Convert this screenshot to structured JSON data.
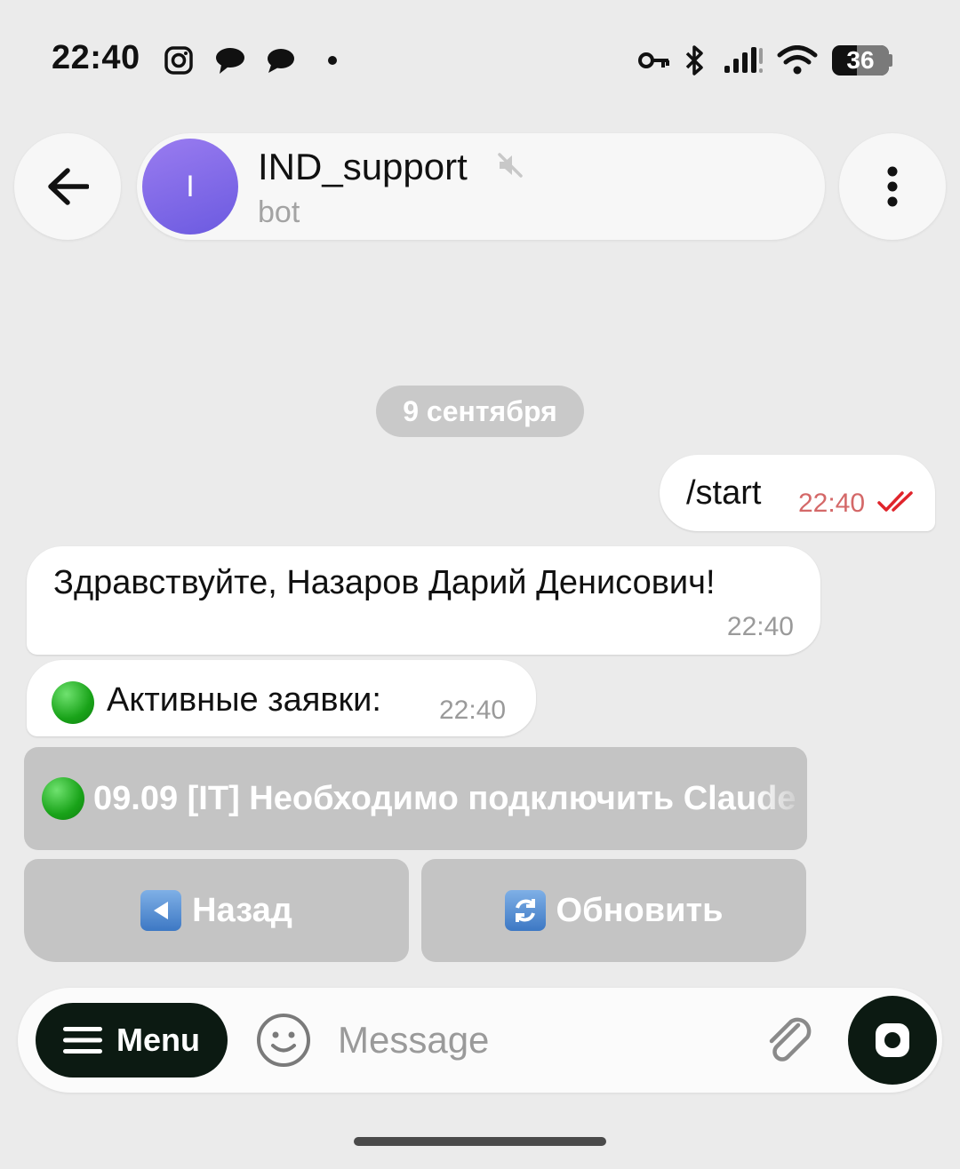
{
  "status_bar": {
    "time": "22:40",
    "battery_level": "36",
    "icons": [
      "instagram-icon",
      "chat-bubbles-icon",
      "message-icon",
      "dot-icon",
      "vpn-key-icon",
      "bluetooth-icon",
      "signal-icon",
      "wifi-icon",
      "battery-icon"
    ]
  },
  "header": {
    "avatar_letter": "I",
    "title": "IND_support",
    "subtitle": "bot",
    "muted": true
  },
  "chat": {
    "date_chip": "9 сентября",
    "messages": [
      {
        "direction": "out",
        "text": "/start",
        "time": "22:40",
        "read": true
      },
      {
        "direction": "in",
        "text": "Здравствуйте, Назаров Дарий Денисович!",
        "time": "22:40"
      },
      {
        "direction": "in",
        "text": "Активные заявки:",
        "time": "22:40"
      }
    ],
    "inline_keyboard": {
      "ticket": "09.09 [IT] Необходимо подключить Claude",
      "back": "Назад",
      "refresh": "Обновить"
    }
  },
  "composer": {
    "menu_label": "Menu",
    "placeholder": "Message"
  },
  "colors": {
    "background": "#ebebeb",
    "bubble": "#ffffff",
    "keyboard_button": "#c4c4c4",
    "accent_dark": "#0c1a12",
    "read_ticks": "#e0242b",
    "out_time": "#d46868"
  }
}
